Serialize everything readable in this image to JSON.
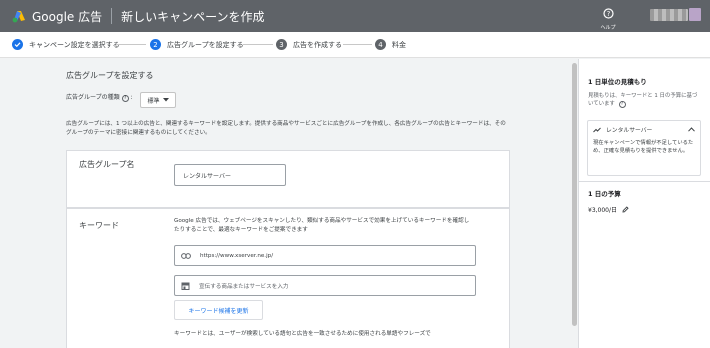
{
  "app": {
    "logo_text": "Google 広告",
    "page_title": "新しいキャンペーンを作成"
  },
  "header": {
    "help_label": "ヘルプ"
  },
  "steps": [
    {
      "number": "",
      "label": "キャンペーン設定を選択する",
      "state": "done"
    },
    {
      "number": "2",
      "label": "広告グループを設定する",
      "state": "current"
    },
    {
      "number": "3",
      "label": "広告を作成する",
      "state": "todo"
    },
    {
      "number": "4",
      "label": "料金",
      "state": "todo"
    }
  ],
  "main": {
    "section_title": "広告グループを設定する",
    "type_label": "広告グループの種類",
    "type_help": "?",
    "type_value": "標準",
    "description": "広告グループには、1 つ以上の広告と、関連するキーワードを設定します。提供する商品やサービスごとに広告グループを作成し、各広告グループの広告とキーワードは、そのグループのテーマに密接に関連するものにしてください。",
    "ad_group_name_label": "広告グループ名",
    "ad_group_name_value": "レンタルサーバー",
    "keywords_label": "キーワード",
    "keywords_description": "Google 広告では、ウェブページをスキャンしたり、類似する商品やサービスで効果を上げているキーワードを確認したりすることで、最適なキーワードをご提案できます",
    "url_value": "https://www.xserver.ne.jp/",
    "product_placeholder": "宣伝する商品またはサービスを入力",
    "update_button": "キーワード候補を更新",
    "keywords_footer": "キーワードとは、ユーザーが検索している語句と広告を一致させるために使用される単語やフレーズで"
  },
  "sidebar": {
    "estimate_title": "1 日単位の見積もり",
    "estimate_text": "見積もりは、キーワードと 1 日の予算に基づいています",
    "estimate_help": "?",
    "estimate_item": "レンタルサーバー",
    "estimate_item_text": "現在キャンペーンで情報が不足しているため、正確な見積もりを提供できません。",
    "budget_title": "1 日の予算",
    "budget_value": "¥3,000/日"
  },
  "colors": {
    "topbar": "#5f6368",
    "accent": "#1a73e8",
    "step_todo": "#5f6368"
  }
}
